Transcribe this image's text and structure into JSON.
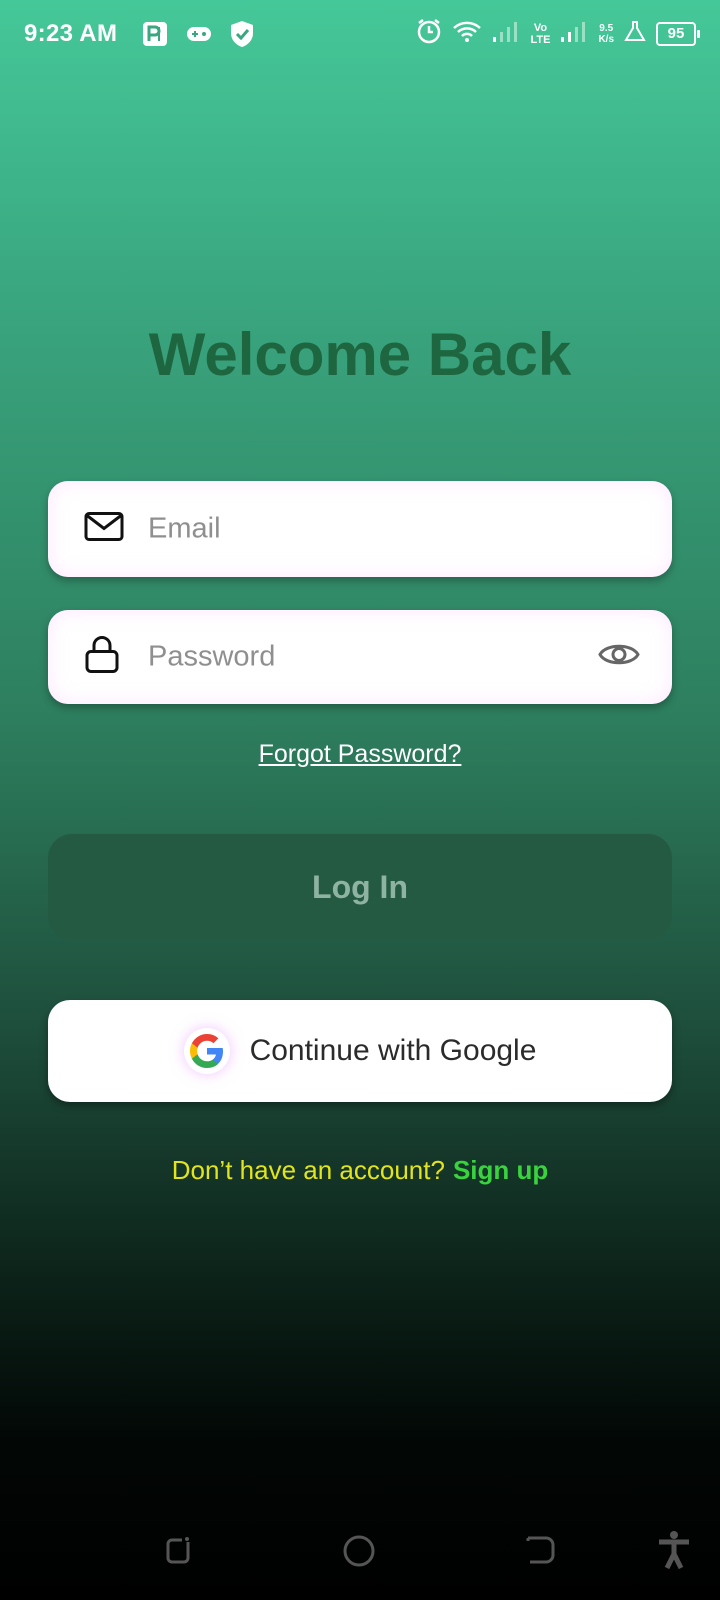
{
  "status_bar": {
    "time": "9:23 AM",
    "network_speed_value": "9.5",
    "network_speed_unit": "K/s",
    "volte_top": "Vo",
    "volte_bottom": "LTE",
    "battery": "95",
    "icons": [
      "parking-icon",
      "game-controller-icon",
      "shield-check-icon",
      "alarm-icon",
      "wifi-icon",
      "signal-icon",
      "signal-icon",
      "flask-icon",
      "battery-icon"
    ]
  },
  "screen": {
    "title": "Welcome Back"
  },
  "form": {
    "email_placeholder": "Email",
    "email_icon": "mail-icon",
    "password_placeholder": "Password",
    "password_icon": "lock-icon",
    "password_toggle_icon": "eye-icon",
    "forgot_label": "Forgot Password?",
    "login_label": "Log In",
    "google_label": "Continue with Google",
    "google_icon": "google-logo-icon"
  },
  "footer": {
    "signup_prompt": "Don’t have an account?",
    "signup_link": "Sign up"
  },
  "nav_bar": {
    "icons": [
      "recents-icon",
      "home-icon",
      "back-icon",
      "accessibility-icon"
    ]
  },
  "colors": {
    "title": "#1e6640",
    "login_bg": "#245a42",
    "signup_prompt": "#e2e41c",
    "signup_link": "#3ad23e"
  }
}
